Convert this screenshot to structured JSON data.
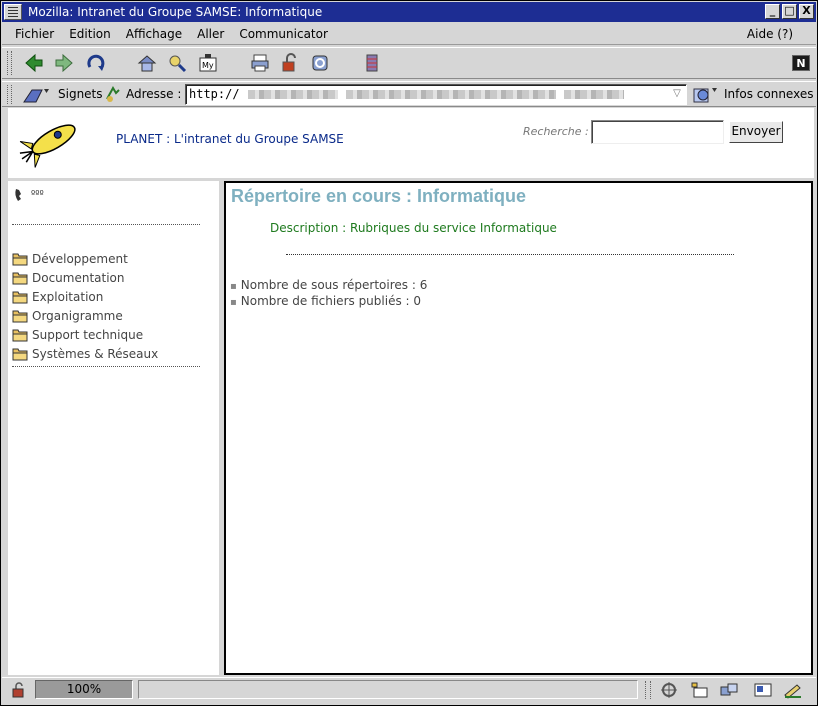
{
  "window": {
    "title": "Mozilla: Intranet du Groupe SAMSE: Informatique",
    "buttons": [
      "_",
      "□",
      "X"
    ]
  },
  "menubar": {
    "items": [
      "Fichier",
      "Edition",
      "Affichage",
      "Aller",
      "Communicator"
    ],
    "help": "Aide (?)"
  },
  "toolbar": {
    "icons": [
      "back-icon",
      "forward-icon",
      "reload-icon",
      "home-icon",
      "search-icon",
      "my-netscape-icon",
      "print-icon",
      "security-icon",
      "shop-icon",
      "stop-icon"
    ],
    "brand": "N"
  },
  "location": {
    "signets_label": "Signets",
    "adresse_label": "Adresse :",
    "url": "http://",
    "infos_label": "Infos connexes"
  },
  "header": {
    "site_title": "PLANET : L'intranet du Groupe SAMSE",
    "search_label": "Recherche :",
    "search_value": "",
    "submit_label": "Envoyer"
  },
  "sidebar": {
    "top_text": "ººº",
    "folders": [
      {
        "label": "Développement"
      },
      {
        "label": "Documentation"
      },
      {
        "label": "Exploitation"
      },
      {
        "label": "Organigramme"
      },
      {
        "label": "Support technique"
      },
      {
        "label": "Systèmes & Réseaux"
      }
    ]
  },
  "main": {
    "title": "Répertoire en cours : Informatique",
    "description": "Description : Rubriques du service Informatique",
    "stats": [
      "Nombre de sous répertoires : 6",
      "Nombre de fichiers publiés : 0"
    ]
  },
  "statusbar": {
    "zoom": "100%",
    "message": ""
  },
  "colors": {
    "titlebar": "#1d2d93",
    "title_accent": "#7fb0c0",
    "description": "#1e7a1e",
    "site_title": "#0a2a8a"
  }
}
